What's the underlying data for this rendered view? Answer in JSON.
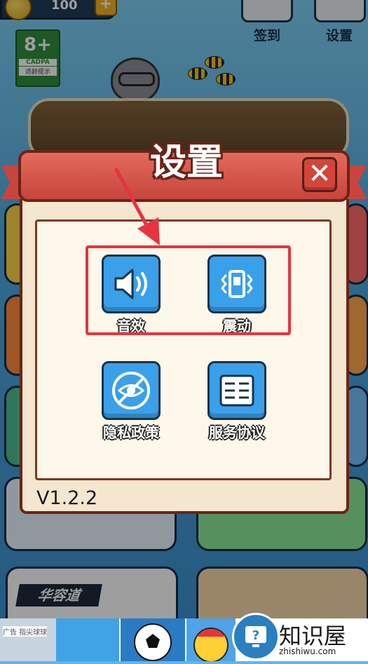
{
  "hud": {
    "coins": "100",
    "coin_plus": "+",
    "checkin_label": "签到",
    "settings_label": "设置"
  },
  "age_badge": {
    "rating": "8+",
    "org": "CADPA",
    "tip": "适龄提示"
  },
  "background_cards": {
    "huarong_label": "华容道"
  },
  "dialog": {
    "title": "设置",
    "close_glyph": "✕",
    "items": [
      {
        "label": "音效",
        "icon": "speaker-icon"
      },
      {
        "label": "震动",
        "icon": "vibration-icon"
      },
      {
        "label": "隐私政策",
        "icon": "privacy-eye-icon"
      },
      {
        "label": "服务协议",
        "icon": "agreement-list-icon"
      }
    ],
    "version": "V1.2.2"
  },
  "ad": {
    "label": "广告 指尖球球"
  },
  "watermark": {
    "text": "知识屋",
    "url": "zhishiwu.com"
  },
  "colors": {
    "ribbon": "#d2453a",
    "button_blue": "#3aa0ea",
    "panel": "#fdf8e9",
    "highlight": "#e8333f"
  }
}
